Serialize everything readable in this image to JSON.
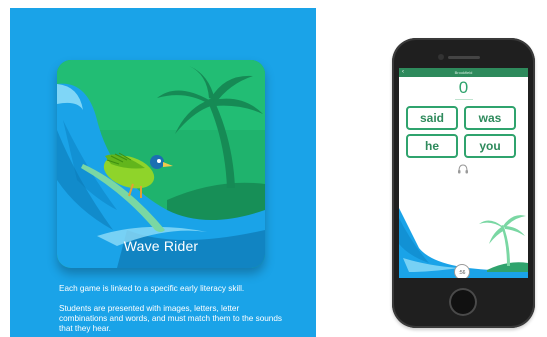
{
  "promo": {
    "card_title": "Wave Rider",
    "description_1": "Each game is linked to a specific early literacy skill.",
    "description_2": "Students are presented with images, letters, letter combinations and words, and must match them to the sounds that they hear."
  },
  "app": {
    "header_title": "Brookfield",
    "back_icon": "chevron-left-icon",
    "score": "0",
    "words": [
      "said",
      "was",
      "he",
      "you"
    ],
    "audio_icon": "headphones-icon",
    "timer": ":56"
  },
  "colors": {
    "panel_blue": "#1aa3e8",
    "card_green": "#1fb36d",
    "app_green": "#2e8a5c",
    "button_border": "#2fa36d"
  }
}
